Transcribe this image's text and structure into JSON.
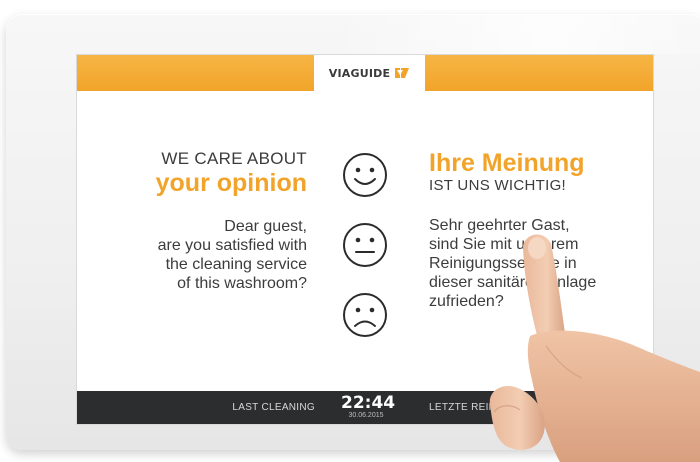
{
  "header": {
    "logo_text": "VIAGUIDE"
  },
  "english": {
    "heading_line1": "WE CARE ABOUT",
    "heading_line2": "your opinion",
    "question": [
      "Dear guest,",
      "are you satisfied with",
      "the cleaning service",
      "of this washroom?"
    ]
  },
  "german": {
    "heading_line1": "Ihre Meinung",
    "heading_line2": "IST UNS WICHTIG!",
    "question": [
      "Sehr geehrter Gast,",
      "sind Sie mit unserem",
      "Reinigungsservice in",
      "dieser sanitären Anlage",
      "zufrieden?"
    ]
  },
  "feedback": {
    "options": [
      {
        "icon": "happy-face-icon"
      },
      {
        "icon": "neutral-face-icon"
      },
      {
        "icon": "sad-face-icon"
      }
    ]
  },
  "status_bar": {
    "last_cleaning_label": "LAST CLEANING",
    "time": "22:44",
    "date": "30.06.2015",
    "letzte_reinigung_label": "LETZTE REINIGUNG"
  },
  "colors": {
    "accent": "#f2a42a",
    "text": "#3c3c3c",
    "bar": "#2c2d2f"
  }
}
